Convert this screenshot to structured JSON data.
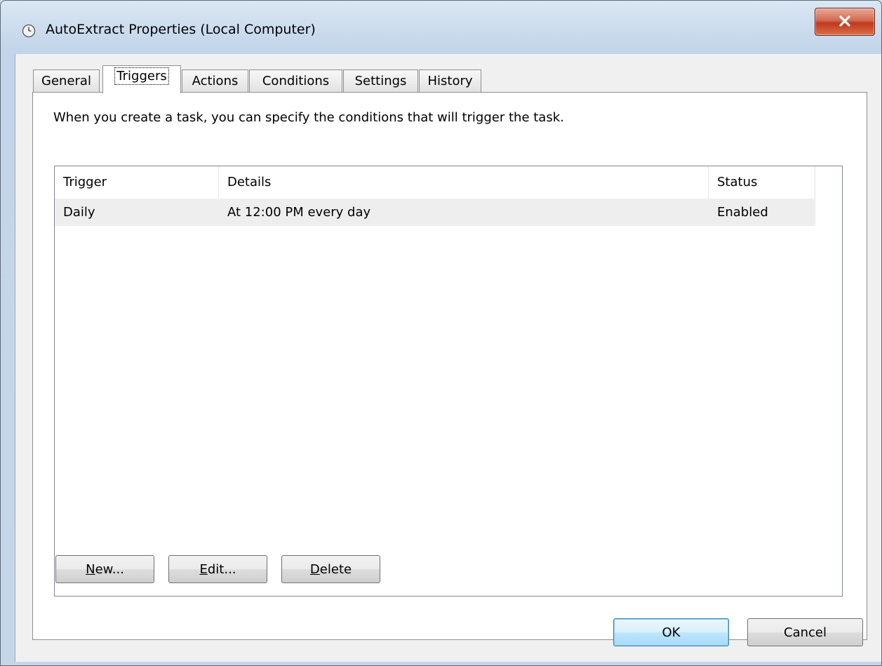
{
  "window": {
    "title": "AutoExtract Properties (Local Computer)"
  },
  "tabs": [
    {
      "label": "General"
    },
    {
      "label": "Triggers"
    },
    {
      "label": "Actions"
    },
    {
      "label": "Conditions"
    },
    {
      "label": "Settings"
    },
    {
      "label": "History"
    }
  ],
  "active_tab": "Triggers",
  "panel": {
    "description": "When you create a task, you can specify the conditions that will trigger the task."
  },
  "list": {
    "columns": [
      "Trigger",
      "Details",
      "Status"
    ],
    "rows": [
      {
        "trigger": "Daily",
        "details": "At 12:00 PM every day",
        "status": "Enabled"
      }
    ]
  },
  "panel_buttons": {
    "new": {
      "accel": "N",
      "rest": "ew..."
    },
    "edit": {
      "accel": "E",
      "rest": "dit..."
    },
    "delete": {
      "accel": "D",
      "rest": "elete"
    }
  },
  "dialog_buttons": {
    "ok": "OK",
    "cancel": "Cancel"
  },
  "icons": {
    "title": "clock-icon",
    "close": "close-icon"
  },
  "colors": {
    "close_button": "#c7432a",
    "default_button_border": "#3c7fb1"
  }
}
